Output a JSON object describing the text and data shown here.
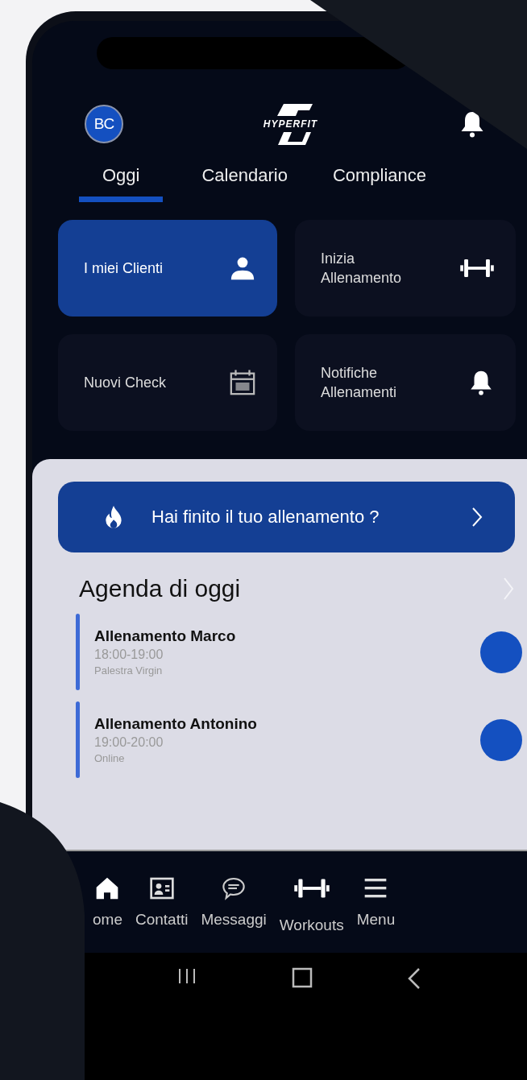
{
  "header": {
    "avatar": "BC",
    "logo": "HYPERFIT"
  },
  "tabs": [
    {
      "label": "Oggi",
      "selected": true
    },
    {
      "label": "Calendario",
      "selected": false
    },
    {
      "label": "Compliance",
      "selected": false
    }
  ],
  "tiles": [
    {
      "label": "I miei Clienti",
      "kind": "person",
      "selected": true
    },
    {
      "label": "Inizia Allenamento",
      "kind": "dumbbell",
      "selected": false
    },
    {
      "label": "Nuovi Check",
      "kind": "calendar",
      "selected": false
    },
    {
      "label": "Notifiche Allenamenti",
      "kind": "bell",
      "selected": false
    }
  ],
  "banner": {
    "text": "Hai finito il tuo allenamento ?"
  },
  "agenda": {
    "title": "Agenda di oggi",
    "items": [
      {
        "title": "Allenamento Marco",
        "time": "18:00-19:00",
        "place": "Palestra Virgin",
        "color": "#1450c0"
      },
      {
        "title": "Allenamento Antonino",
        "time": "19:00-20:00",
        "place": "Online",
        "color": "#1450c0"
      }
    ]
  },
  "nav": [
    {
      "label": "ome",
      "kind": "home"
    },
    {
      "label": "Contatti",
      "kind": "contact"
    },
    {
      "label": "Messaggi",
      "kind": "chat"
    },
    {
      "label": "Workouts",
      "kind": "dumbbell"
    },
    {
      "label": "Menu",
      "kind": "menu"
    }
  ]
}
